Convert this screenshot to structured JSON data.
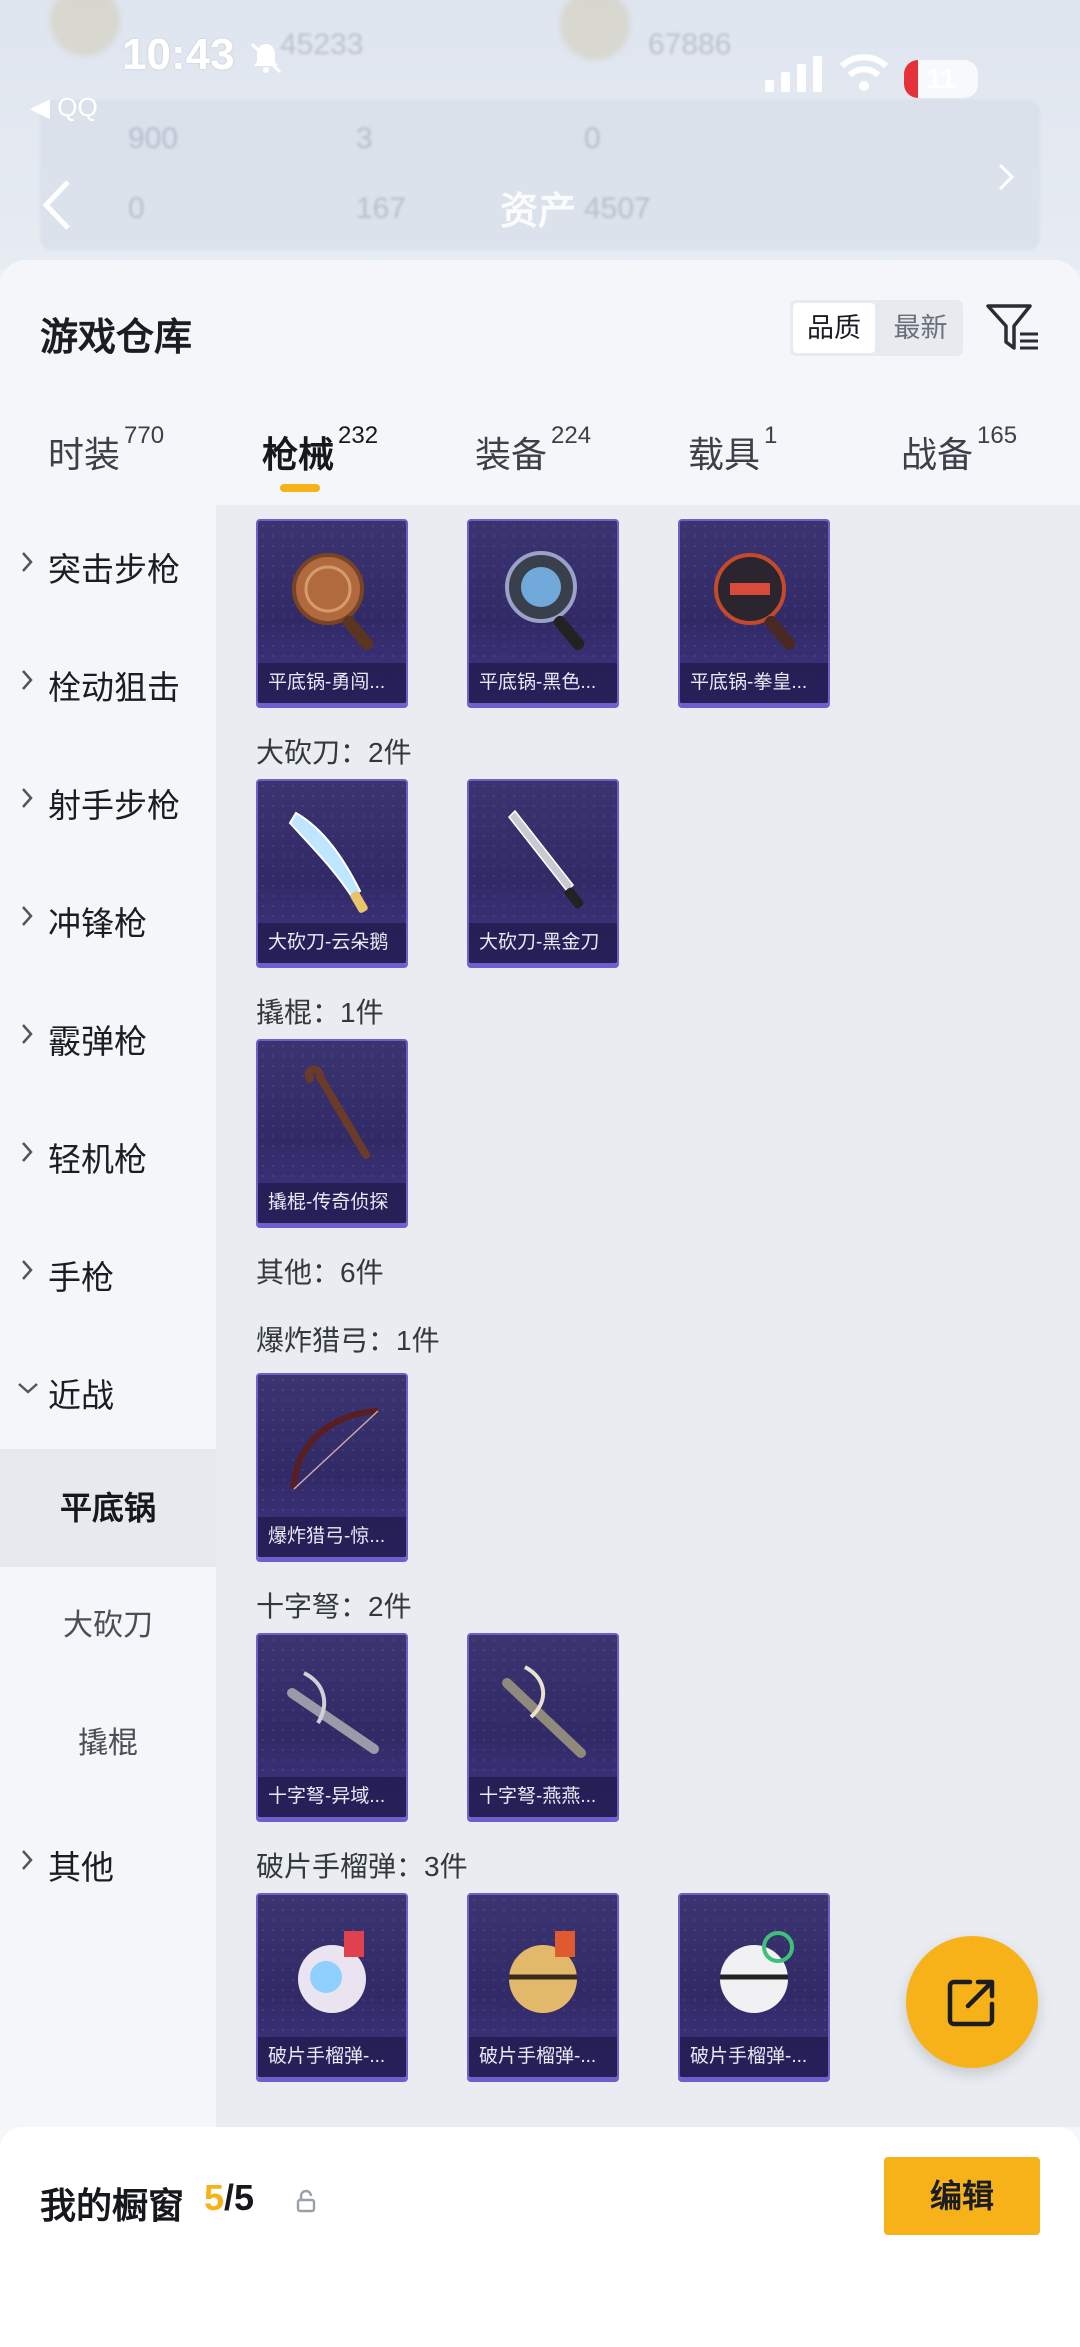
{
  "status_bar": {
    "time": "10:43",
    "battery": "11",
    "back_source": "◀ QQ"
  },
  "header": {
    "title": "资产",
    "ghost_values": [
      "45233",
      "67886",
      "900",
      "3",
      "0",
      "0",
      "167",
      "4507"
    ]
  },
  "sheet": {
    "title": "游戏仓库",
    "sort": {
      "options": [
        "品质",
        "最新"
      ],
      "active": "品质"
    }
  },
  "tabs": [
    {
      "label": "时装",
      "count": "770"
    },
    {
      "label": "枪械",
      "count": "232",
      "active": true
    },
    {
      "label": "装备",
      "count": "224"
    },
    {
      "label": "载具",
      "count": "1"
    },
    {
      "label": "战备",
      "count": "165"
    }
  ],
  "sidebar": {
    "categories": [
      "突击步枪",
      "栓动狙击",
      "射手步枪",
      "冲锋枪",
      "霰弹枪",
      "轻机枪",
      "手枪",
      "近战"
    ],
    "subcategories": [
      "平底锅",
      "大砍刀",
      "撬棍"
    ],
    "active_sub": "平底锅",
    "last": "其他"
  },
  "content": {
    "sections": [
      {
        "title": "",
        "items": [
          "平底锅-勇闯...",
          "平底锅-黑色...",
          "平底锅-拳皇..."
        ]
      },
      {
        "title": "大砍刀：2件",
        "items": [
          "大砍刀-云朵鹅",
          "大砍刀-黑金刀"
        ]
      },
      {
        "title": "撬棍：1件",
        "items": [
          "撬棍-传奇侦探"
        ]
      },
      {
        "title": "其他：6件",
        "items": []
      },
      {
        "title": "爆炸猎弓：1件",
        "items": [
          "爆炸猎弓-惊..."
        ]
      },
      {
        "title": "十字弩：2件",
        "items": [
          "十字弩-异域...",
          "十字弩-燕燕..."
        ]
      },
      {
        "title": "破片手榴弹：3件",
        "items": [
          "破片手榴弹-...",
          "破片手榴弹-...",
          "破片手榴弹-..."
        ]
      }
    ]
  },
  "bottom_bar": {
    "label": "我的橱窗",
    "current": "5",
    "total": "/5",
    "edit": "编辑"
  },
  "colors": {
    "accent": "#f7b21a",
    "item_bg": "#312a66",
    "item_border": "#6d61c8"
  },
  "icons": [
    "bell-mute-icon",
    "signal-icon",
    "wifi-icon",
    "battery-icon",
    "back-chevron-icon",
    "filter-icon",
    "share-icon",
    "lock-icon"
  ]
}
